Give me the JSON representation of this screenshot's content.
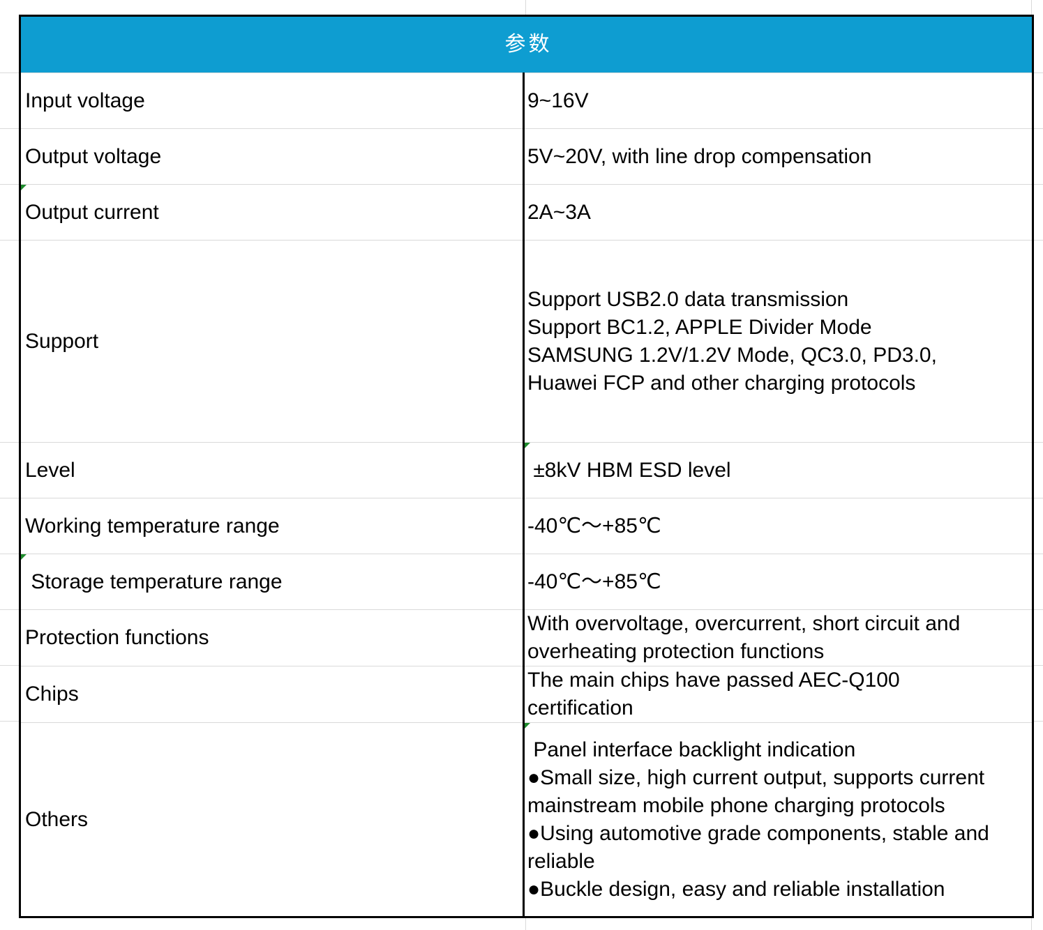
{
  "header": {
    "title": "参数"
  },
  "rows": [
    {
      "label": "Input voltage",
      "value": [
        "9~16V"
      ]
    },
    {
      "label": "Output voltage",
      "value": [
        "5V~20V, with line drop compensation"
      ]
    },
    {
      "label": "Output current",
      "value": [
        "2A~3A"
      ]
    },
    {
      "label": "Support",
      "value": [
        "Support USB2.0 data transmission",
        "Support BC1.2, APPLE Divider Mode",
        "SAMSUNG 1.2V/1.2V Mode, QC3.0, PD3.0,",
        "Huawei FCP and other charging protocols"
      ]
    },
    {
      "label": "Level",
      "value": [
        " ±8kV HBM ESD level"
      ]
    },
    {
      "label": "Working temperature range",
      "value": [
        "-40℃～+85℃"
      ]
    },
    {
      "label": " Storage temperature range",
      "value": [
        "-40℃～+85℃"
      ]
    },
    {
      "label": "Protection functions",
      "value": [
        "With overvoltage, overcurrent, short circuit and",
        "overheating protection functions"
      ]
    },
    {
      "label": "Chips",
      "value": [
        "The main chips have passed AEC-Q100",
        "certification"
      ]
    },
    {
      "label": "Others",
      "value": [
        " Panel interface backlight indication",
        "●Small size, high current output, supports current",
        "mainstream mobile phone charging protocols",
        "●Using automotive grade components, stable and",
        "reliable",
        "●Buckle design, easy and reliable installation"
      ]
    }
  ],
  "colors": {
    "header_bg": "#0e9dd1",
    "header_text": "#ffffff",
    "border": "#000000",
    "gridline": "#d9d9d9",
    "comment_marker": "#1e8c2d"
  }
}
